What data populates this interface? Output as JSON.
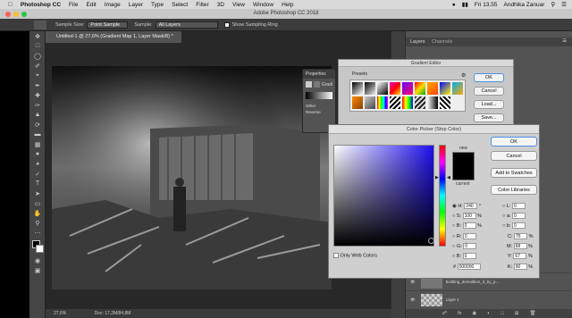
{
  "menubar": {
    "apple": "",
    "app": "Photoshop CC",
    "items": [
      "File",
      "Edit",
      "Image",
      "Layer",
      "Type",
      "Select",
      "Filter",
      "3D",
      "View",
      "Window",
      "Help"
    ],
    "clock": "Fri 13.55",
    "user": "Andhika Zanuar"
  },
  "window": {
    "title": "Adobe Photoshop CC 2018"
  },
  "options": {
    "sample_size_label": "Sample Size:",
    "sample_size_value": "Point Sample",
    "sample_label": "Sample:",
    "sample_value": "All Layers",
    "ring_label": "Show Sampling Ring"
  },
  "document": {
    "tab_title": "Untitled-1 @ 27,6% (Gradient Map 1, Layer Mask/8) *",
    "zoom": "27,6%",
    "doc_info": "Doc: 17,2M/84,8M"
  },
  "panels": {
    "tabs": [
      "Layers",
      "Channels"
    ],
    "layer_name_1": "building_demolition_3_by_p...",
    "layer_name_2": "Layer 1"
  },
  "properties": {
    "title": "Properties",
    "grad_label": "Gradi",
    "other_label": "Other",
    "reverse_label": "Reverse"
  },
  "gradient_editor": {
    "title": "Gradient Editor",
    "presets_label": "Presets",
    "ok": "OK",
    "cancel": "Cancel",
    "load": "Load...",
    "save": "Save..."
  },
  "color_picker": {
    "title": "Color Picker (Stop Color)",
    "new_label": "new",
    "current_label": "current",
    "ok": "OK",
    "cancel": "Cancel",
    "add_swatches": "Add to Swatches",
    "color_libraries": "Color Libraries",
    "only_web": "Only Web Colors",
    "H": "240",
    "S": "100",
    "Bv": "0",
    "R": "0",
    "G": "0",
    "B": "0",
    "L": "0",
    "a": "0",
    "b": "0",
    "C": "75",
    "M": "68",
    "Y": "67",
    "K": "90",
    "hex": "000000",
    "deg": "°",
    "pct": "%"
  },
  "colors": {
    "hue_base": "#1f10f0",
    "new_swatch": "#000000"
  }
}
